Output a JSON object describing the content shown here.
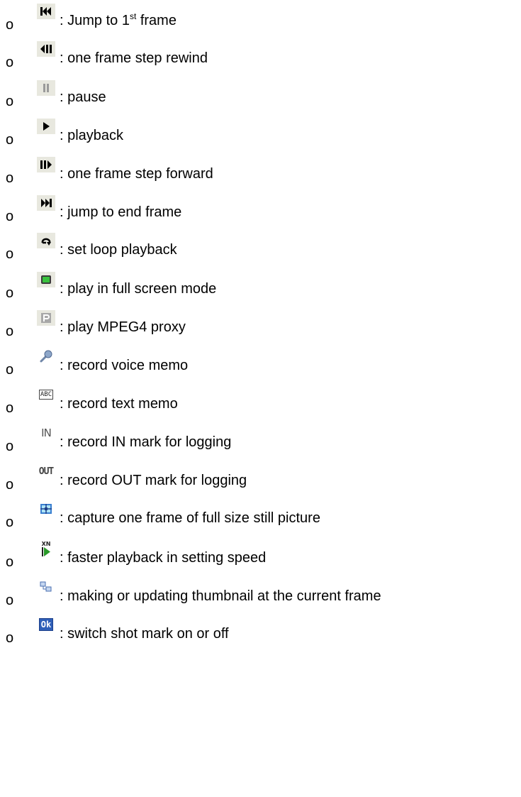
{
  "bullet": "o",
  "items": [
    {
      "icon": "skip-to-start-icon",
      "prefix": ":  Jump to 1",
      "sup": "st",
      "suffix": " frame"
    },
    {
      "icon": "step-rewind-icon",
      "text": ": one frame step rewind"
    },
    {
      "icon": "pause-icon",
      "text": ": pause"
    },
    {
      "icon": "play-icon",
      "text": ": playback"
    },
    {
      "icon": "step-forward-icon",
      "text": ": one frame step forward"
    },
    {
      "icon": "skip-to-end-icon",
      "text": ": jump to end frame"
    },
    {
      "icon": "loop-icon",
      "text": ": set loop playback"
    },
    {
      "icon": "fullscreen-icon",
      "text": ": play in full screen mode"
    },
    {
      "icon": "proxy-p-icon",
      "text": ": play MPEG4 proxy"
    },
    {
      "icon": "microphone-icon",
      "text": ": record voice memo"
    },
    {
      "icon": "abc-memo-icon",
      "text": ": record text memo",
      "icon_text": "ABC"
    },
    {
      "icon": "in-mark-icon",
      "text": ": record IN mark for logging",
      "icon_text": "IN"
    },
    {
      "icon": "out-mark-icon",
      "text": ": record OUT mark for logging",
      "icon_text": "OUT"
    },
    {
      "icon": "capture-frame-icon",
      "text": ": capture one frame of full size still picture"
    },
    {
      "icon": "fast-forward-speed-icon",
      "text": ": faster playback in setting speed",
      "icon_text": "XN"
    },
    {
      "icon": "thumbnail-icon",
      "text": ": making or updating thumbnail at the current frame"
    },
    {
      "icon": "ok-shot-mark-icon",
      "text": ": switch shot mark on or off",
      "icon_text": "Ok"
    }
  ],
  "colors": {
    "icon_bg": "#e8e8df",
    "accent_blue": "#2f5fb8",
    "green": "#2a9a2a"
  }
}
